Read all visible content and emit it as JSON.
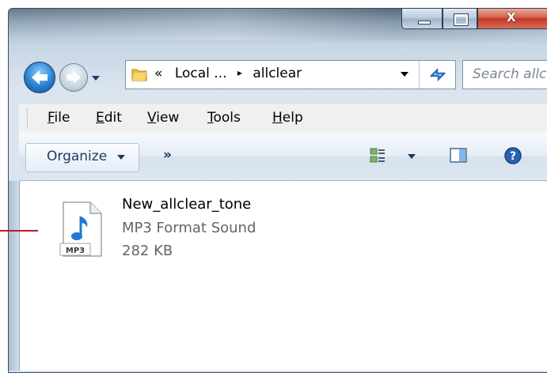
{
  "window": {
    "caption_buttons": {
      "minimize": "minimize",
      "maximize": "maximize",
      "close": "X"
    }
  },
  "address_bar": {
    "overflow": "«",
    "crumbs": [
      "Local ...",
      "allclear"
    ],
    "separator": "▸"
  },
  "search": {
    "placeholder": "Search allclear"
  },
  "menu": [
    {
      "label": "File",
      "accel": "F",
      "rest": "ile"
    },
    {
      "label": "Edit",
      "accel": "E",
      "rest": "dit"
    },
    {
      "label": "View",
      "accel": "V",
      "rest": "iew"
    },
    {
      "label": "Tools",
      "accel": "T",
      "rest": "ools"
    },
    {
      "label": "Help",
      "accel": "H",
      "rest": "elp"
    }
  ],
  "toolbar": {
    "organize_label": "Organize",
    "more_label": "»"
  },
  "file": {
    "name": "New_allclear_tone",
    "type": "MP3 Format Sound",
    "size": "282 KB",
    "badge": "MP3"
  },
  "colors": {
    "accent_pointer": "#c0192b",
    "toolbar_text": "#1e395b",
    "secondary_text": "#646464"
  }
}
